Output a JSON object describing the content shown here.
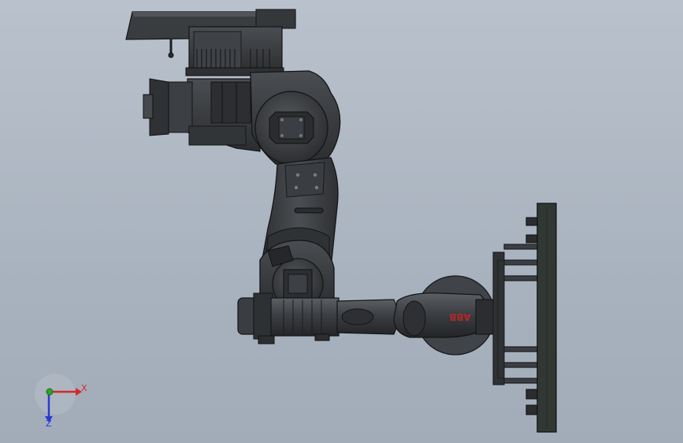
{
  "view": {
    "background": "#aeb7c2",
    "model_colors": {
      "body": "#3b3d40",
      "body_dark": "#2a2c2e",
      "body_light": "#55585c",
      "edge": "#151617",
      "plate": "#343a36",
      "logo": "#b3272a"
    }
  },
  "model": {
    "logo_text": "ABB"
  },
  "triad": {
    "x_label": "X",
    "z_label": "Z",
    "x_color": "#d42a2a",
    "y_color": "#2aa52a",
    "z_color": "#2a3ad4"
  }
}
